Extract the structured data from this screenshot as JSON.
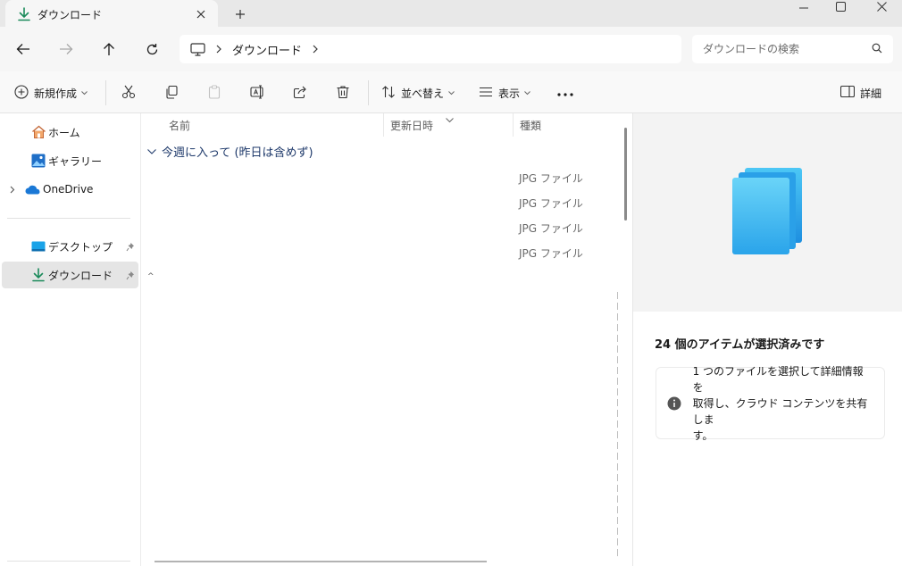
{
  "tab": {
    "title": "ダウンロード"
  },
  "address": {
    "crumb": "ダウンロード"
  },
  "search": {
    "placeholder": "ダウンロードの検索"
  },
  "toolbar": {
    "new_label": "新規作成",
    "sort_label": "並べ替え",
    "view_label": "表示",
    "details_label": "詳細"
  },
  "sidebar": {
    "home": "ホーム",
    "gallery": "ギャラリー",
    "onedrive": "OneDrive",
    "desktop": "デスクトップ",
    "downloads": "ダウンロード"
  },
  "columns": {
    "name": "名前",
    "modified": "更新日時",
    "type": "種類"
  },
  "group": {
    "label": "今週に入って (昨日は含めず)"
  },
  "files": [
    {
      "type": "JPG ファイル"
    },
    {
      "type": "JPG ファイル"
    },
    {
      "type": "JPG ファイル"
    },
    {
      "type": "JPG ファイル"
    }
  ],
  "details": {
    "selection_title": "24 個のアイテムが選択済みです",
    "info_line1": "1 つのファイルを選択して詳細情報を",
    "info_line2": "取得し、クラウド コンテンツを共有しま",
    "info_line3": "す。"
  },
  "colors": {
    "accent": "#0f7c6c",
    "folder_blue": "#1aa3e8",
    "selected_bg": "#e5e5e5"
  }
}
